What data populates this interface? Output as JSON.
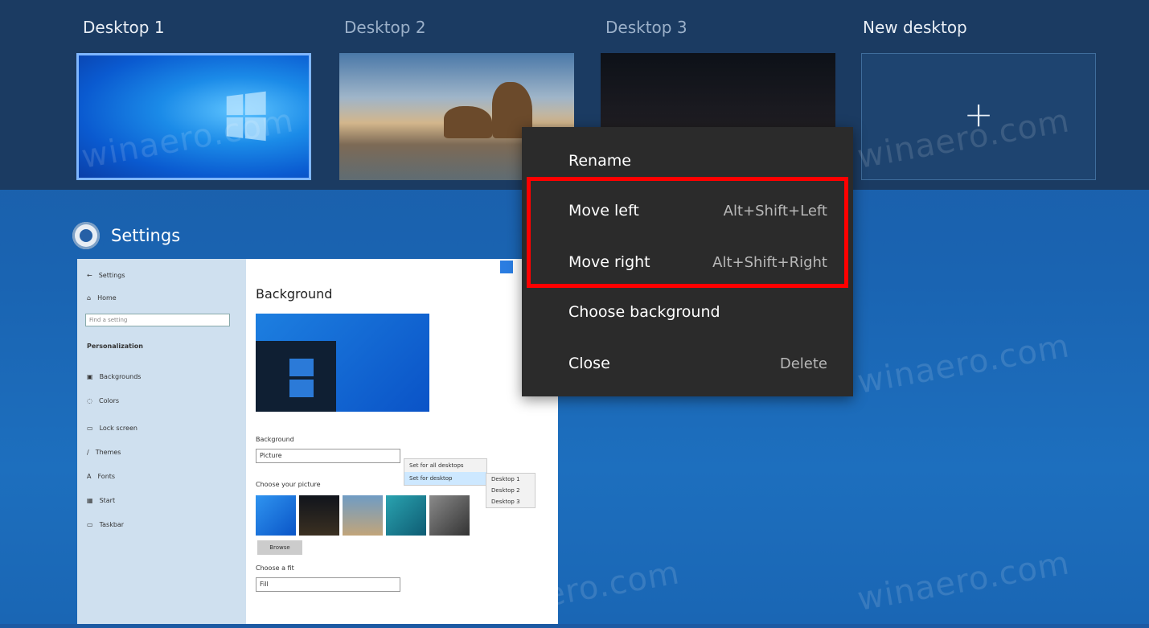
{
  "desktops": [
    {
      "label": "Desktop 1",
      "selected": true
    },
    {
      "label": "Desktop 2",
      "selected": false
    },
    {
      "label": "Desktop 3",
      "selected": false
    },
    {
      "label": "New desktop",
      "selected": false
    }
  ],
  "new_desktop_symbol": "+",
  "window": {
    "title": "Settings",
    "app": {
      "back_label": "Settings",
      "nav": [
        "Home",
        "Backgrounds",
        "Colors",
        "Lock screen",
        "Themes",
        "Fonts",
        "Start",
        "Taskbar"
      ],
      "search_placeholder": "Find a setting",
      "section": "Personalization",
      "heading": "Background",
      "bg_label": "Background",
      "bg_value": "Picture",
      "choose_picture_label": "Choose your picture",
      "browse_label": "Browse",
      "fit_label": "Choose a fit",
      "fit_value": "Fill",
      "context_items": [
        "Set for all desktops",
        "Set for desktop"
      ],
      "submenu_items": [
        "Desktop 1",
        "Desktop 2",
        "Desktop 3"
      ]
    }
  },
  "context_menu": {
    "items": [
      {
        "label": "Rename",
        "shortcut": ""
      },
      {
        "label": "Move left",
        "shortcut": "Alt+Shift+Left"
      },
      {
        "label": "Move right",
        "shortcut": "Alt+Shift+Right"
      },
      {
        "label": "Choose background",
        "shortcut": ""
      },
      {
        "label": "Close",
        "shortcut": "Delete"
      }
    ]
  },
  "watermark": "winaero.com",
  "colors": {
    "highlight": "#ff0000",
    "menu_bg": "#2b2b2b",
    "strip_bg": "#1b3b62",
    "selection_border": "#7fb6ff"
  }
}
